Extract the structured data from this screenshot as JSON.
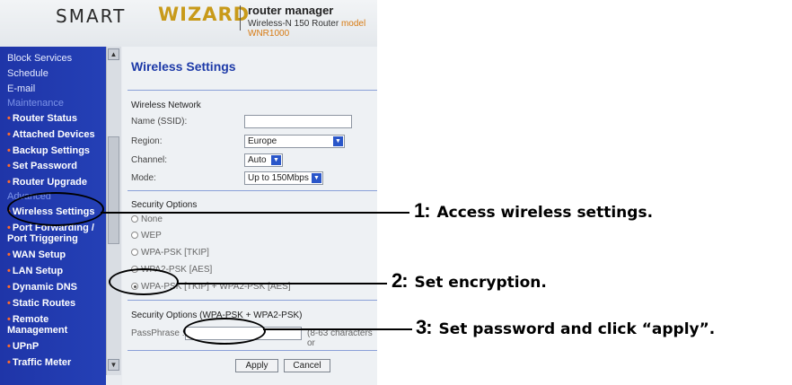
{
  "header": {
    "brand_smart": "SMART",
    "brand_wizard": "WIZARD",
    "product_title": "router manager",
    "product_model_prefix": "Wireless-N 150 Router",
    "product_model": "model WNR1000"
  },
  "sidebar": {
    "items": [
      {
        "label": "Block Services"
      },
      {
        "label": "Schedule"
      },
      {
        "label": "E-mail"
      },
      {
        "label": "Maintenance"
      },
      {
        "label": "Router Status"
      },
      {
        "label": "Attached Devices"
      },
      {
        "label": "Backup Settings"
      },
      {
        "label": "Set Password"
      },
      {
        "label": "Router Upgrade"
      },
      {
        "label": "Advanced"
      },
      {
        "label": "Wireless Settings"
      },
      {
        "label": "Port Forwarding /"
      },
      {
        "label": "Port Triggering"
      },
      {
        "label": "WAN Setup"
      },
      {
        "label": "LAN Setup"
      },
      {
        "label": "Dynamic DNS"
      },
      {
        "label": "Static Routes"
      },
      {
        "label": "Remote"
      },
      {
        "label": "Management"
      },
      {
        "label": "UPnP"
      },
      {
        "label": "Traffic Meter"
      }
    ]
  },
  "main": {
    "title": "Wireless Settings",
    "wireless_network": {
      "heading": "Wireless Network",
      "ssid_label": "Name (SSID):",
      "ssid_value": "",
      "region_label": "Region:",
      "region_value": "Europe",
      "channel_label": "Channel:",
      "channel_value": "Auto",
      "mode_label": "Mode:",
      "mode_value": "Up to 150Mbps"
    },
    "security": {
      "heading": "Security Options",
      "options": [
        {
          "label": "None"
        },
        {
          "label": "WEP"
        },
        {
          "label": "WPA-PSK [TKIP]"
        },
        {
          "label": "WPA2-PSK [AES]"
        },
        {
          "label": "WPA-PSK [TKIP] + WPA2-PSK [AES]"
        }
      ],
      "selected_index": 4
    },
    "passphrase_section": {
      "heading": "Security Options (WPA-PSK + WPA2-PSK)",
      "label": "PassPhrase :",
      "value": "",
      "hint": "(8-63 characters or"
    },
    "buttons": {
      "apply": "Apply",
      "cancel": "Cancel"
    }
  },
  "callouts": [
    {
      "number": "1:",
      "text": "Access wireless settings",
      "end": "."
    },
    {
      "number": "2:",
      "text": "Set encryption",
      "end": "."
    },
    {
      "number": "3:",
      "text": "Set password and click “apply”",
      "end": "."
    }
  ],
  "colors": {
    "sidebar_bg": "#2440b6",
    "title_blue": "#1d3aa8",
    "bullet_orange": "#ff6a2c",
    "brand_gold": "#c89a1a"
  }
}
